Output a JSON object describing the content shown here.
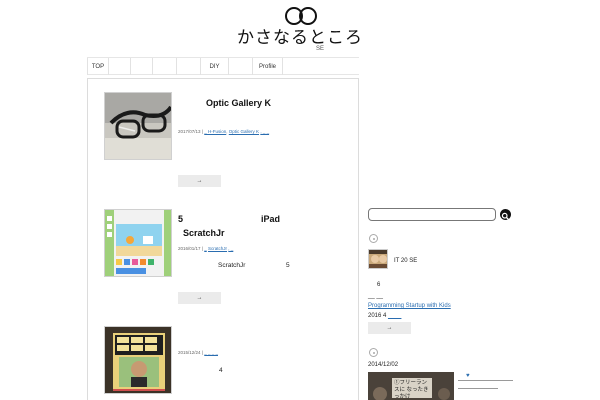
{
  "site": {
    "title": "かさなるところ",
    "subtitle": "SE"
  },
  "nav": [
    {
      "label": "TOP"
    },
    {
      "label": ""
    },
    {
      "label": ""
    },
    {
      "label": ""
    },
    {
      "label": ""
    },
    {
      "label": "DIY"
    },
    {
      "label": ""
    },
    {
      "label": "Profile"
    }
  ],
  "posts": [
    {
      "title": "Optic Gallery K",
      "date": "2017/07/13",
      "sep": "|",
      "cat1": "_ H-Fusion",
      "cat_sep": ",",
      "cat2": "Optic Gallery K",
      "cat3": ",  _  _",
      "excerpt": "",
      "more": "→"
    },
    {
      "title_line1": "5",
      "title_line1b": "iPad",
      "title_line2": "ScratchJr",
      "date": "2016/01/17",
      "sep": "|",
      "cat1": "_",
      "cat2": "ScratchJr",
      "cat3": ",  _",
      "excerpt_a": "ScratchJr",
      "excerpt_b": "5",
      "more": "→"
    },
    {
      "date": "2015/12/24",
      "sep": "|",
      "cat1": "_  _  _  _",
      "excerpt": "4"
    }
  ],
  "sidebar": {
    "search": {
      "value": "",
      "placeholder": ""
    },
    "profile_text": "IT 20  SE",
    "profile_count": "6",
    "profile_dashes": "__  __",
    "book_link": "Programming Startup with Kids",
    "book_date_prefix": "2016 4",
    "book_date_link": "____",
    "book_more": "→",
    "post_date": "2014/12/02",
    "post_caption": "①フリーランスに なったきっかけ",
    "post_heart": "♥"
  },
  "colors": {
    "link": "#2a6db0",
    "button": "#ebebeb",
    "border": "#dcdcdc"
  }
}
